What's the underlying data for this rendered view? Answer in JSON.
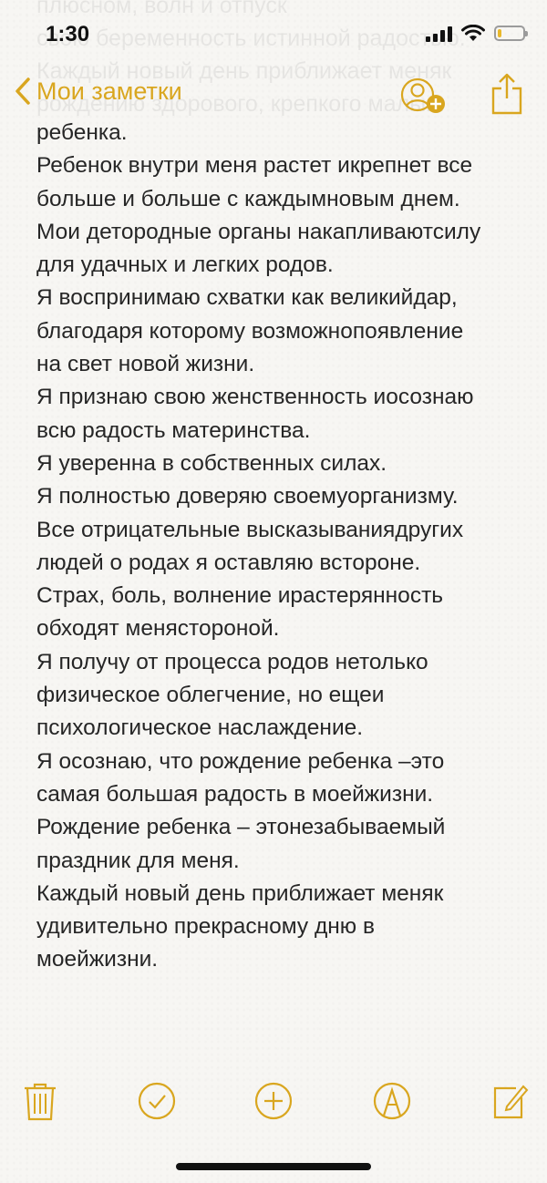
{
  "status_bar": {
    "time": "1:30"
  },
  "nav": {
    "back_label": "Мои заметки"
  },
  "ghost_lines": [
    "плюсном, волн и отпуск",
    "свою беременность истинной радостью.",
    "Каждый новый день приближает меняк",
    "рождению здорового, крепкого малыш",
    "ребенка."
  ],
  "note": {
    "lines": [
      "ребенка.",
      "Ребенок внутри меня растет икрепнет все",
      "больше и больше с каждымновым днем.",
      "Мои детородные органы накапливаютсилу",
      "для удачных и легких родов.",
      "Я воспринимаю схватки как великийдар,",
      "благодаря которому возможнопоявление",
      "на свет новой жизни.",
      "Я признаю свою женственность иосознаю",
      "всю радость материнства.",
      "Я уверенна в собственных силах.",
      "Я полностью доверяю своемуорганизму.",
      "Все отрицательные высказываниядругих",
      "людей о родах я оставляю всторонe.",
      "Страх, боль, волнение ирастерянность",
      "обходят менясторoной.",
      "Я получу от процесса родов нетолько",
      "физическое облегчение, но ещеи",
      "психологическое наслаждение.",
      "Я осознаю, что рождение ребенка –это",
      "самая большая радость в моейжизни.",
      "Рождение ребенка – этонезабываемый",
      "праздник для меня.",
      "Каждый новый день приближает меняк",
      "удивительно прекрасному дню в",
      "моейжизни."
    ]
  },
  "colors": {
    "accent": "#d9a61f",
    "text": "#262626",
    "background": "#f7f6f3"
  },
  "icons": {
    "back": "chevron-left-icon",
    "collaborate": "add-person-icon",
    "share": "share-icon",
    "delete": "trash-icon",
    "checklist": "checkmark-circle-icon",
    "new_item": "plus-circle-icon",
    "markup": "pen-circle-icon",
    "compose": "compose-icon"
  }
}
